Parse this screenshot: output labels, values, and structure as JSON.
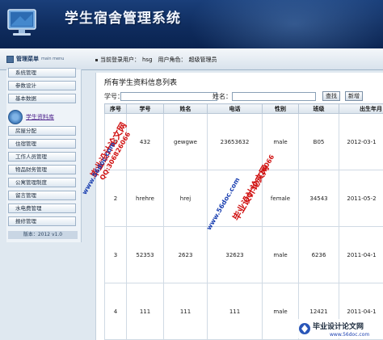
{
  "app": {
    "title": "学生宿舍管理系统"
  },
  "subbar": {
    "menu_title": "管理菜单",
    "menu_subtitle": "main menu",
    "user_label": "当前登录用户：",
    "user_name": "hsg",
    "role_label": "用户角色：",
    "role_name": "超级管理员"
  },
  "sidebar": {
    "items_top": [
      "系统管理",
      "参数设计",
      "基本数据"
    ],
    "active_item": "学生资料库",
    "items_bottom": [
      "房屋分配",
      "住宿管理",
      "工作人员管理",
      "物品财务管理",
      "公寓管理制度",
      "留言管理",
      "水电费管理",
      "报修管理"
    ],
    "version": "版本：2012  v1.0"
  },
  "main": {
    "section_title": "所有学生资料信息列表",
    "student_id_label": "学号：",
    "name_label": "姓名：",
    "search_button": "查找",
    "add_button": "新增"
  },
  "table": {
    "headers": [
      "序号",
      "学号",
      "姓名",
      "电话",
      "性别",
      "班级",
      "出生年月"
    ],
    "rows": [
      [
        "1",
        "432",
        "gewgwe",
        "23653632",
        "male",
        "B05",
        "2012-03-1"
      ],
      [
        "2",
        "hrehre",
        "hrej",
        "",
        "female",
        "34543",
        "2011-05-2"
      ],
      [
        "3",
        "52353",
        "2623",
        "32623",
        "male",
        "6236",
        "2011-04-1"
      ],
      [
        "4",
        "111",
        "111",
        "111",
        "male",
        "12421",
        "2011-04-1"
      ]
    ]
  },
  "watermarks": {
    "cn": "毕业设计论文网",
    "url": "www.56doc.com",
    "qq": "QQ:306826066"
  },
  "corner_logo": {
    "text": "毕业设计论文网",
    "url": "www.56doc.com"
  },
  "colors": {
    "header_bg": "#0f2c5e",
    "watermark_red": "#d01010",
    "watermark_blue": "#1a3fb0"
  }
}
